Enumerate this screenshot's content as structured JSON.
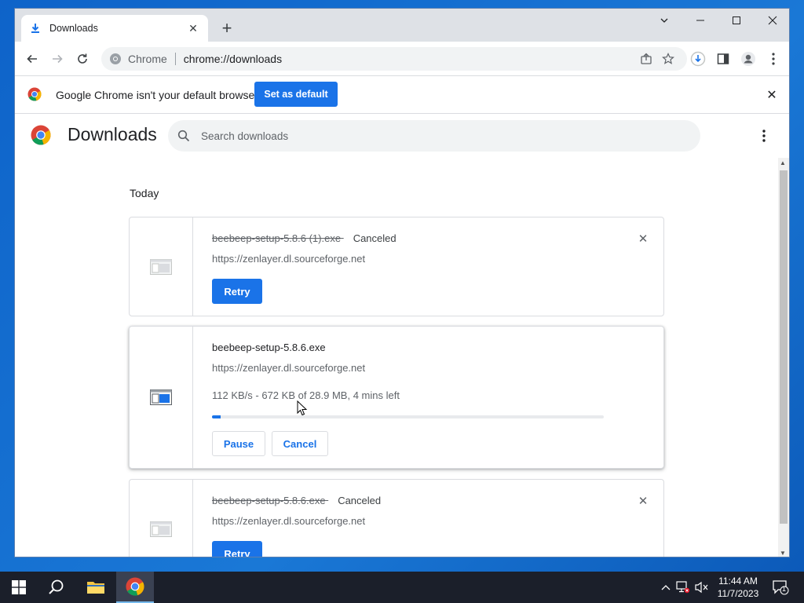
{
  "browser": {
    "tab_title": "Downloads",
    "new_tab_label": "+",
    "omnibox_site": "Chrome",
    "omnibox_url": "chrome://downloads"
  },
  "infobar": {
    "message": "Google Chrome isn't your default browser",
    "button": "Set as default"
  },
  "page": {
    "title": "Downloads",
    "search_placeholder": "Search downloads"
  },
  "downloads": {
    "date_header": "Today",
    "items": [
      {
        "file_name": "beebeep-setup-5.8.6 (1).exe",
        "status": "Canceled",
        "url": "https://zenlayer.dl.sourceforge.net",
        "action": "Retry"
      },
      {
        "file_name": "beebeep-setup-5.8.6.exe",
        "status": "",
        "url": "https://zenlayer.dl.sourceforge.net",
        "progress_text": "112 KB/s - 672 KB of 28.9 MB, 4 mins left",
        "progress_fraction": 0.023,
        "pause_label": "Pause",
        "cancel_label": "Cancel"
      },
      {
        "file_name": "beebeep-setup-5.8.6.exe",
        "status": "Canceled",
        "url": "https://zenlayer.dl.sourceforge.net",
        "action": "Retry"
      }
    ]
  },
  "taskbar": {
    "time": "11:44 AM",
    "date": "11/7/2023",
    "notification_count": "1"
  },
  "colors": {
    "accent": "#1a73e8",
    "taskbar": "#1b1f2a",
    "desktop": "#1565c8"
  }
}
